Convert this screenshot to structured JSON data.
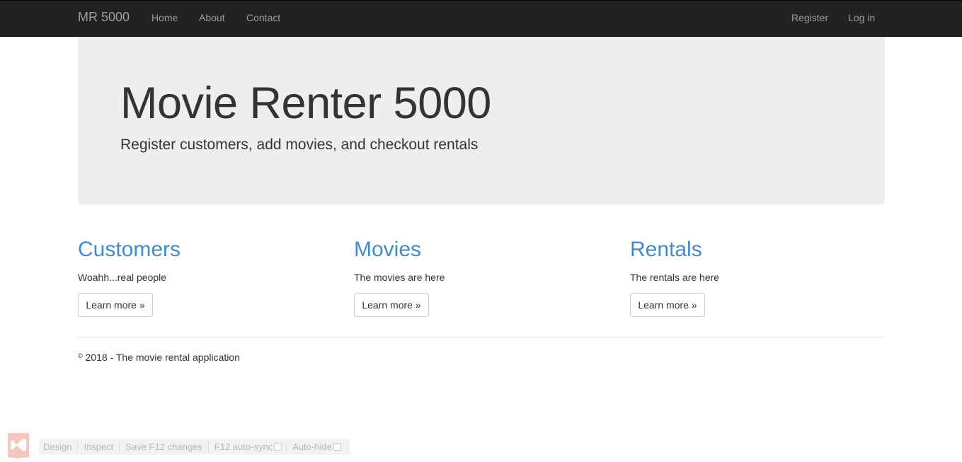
{
  "navbar": {
    "brand": "MR 5000",
    "links": [
      "Home",
      "About",
      "Contact"
    ],
    "register": "Register",
    "login": "Log in"
  },
  "jumbotron": {
    "title": "Movie Renter 5000",
    "lead": "Register customers, add movies, and checkout rentals"
  },
  "sections": [
    {
      "title": "Customers",
      "text": "Woahh...real people",
      "button": "Learn more »"
    },
    {
      "title": "Movies",
      "text": "The movies are here",
      "button": "Learn more »"
    },
    {
      "title": "Rentals",
      "text": "The rentals are here",
      "button": "Learn more »"
    }
  ],
  "footer": {
    "copyright_symbol": "©",
    "text": "2018 - The movie rental application"
  },
  "devbar": {
    "design": "Design",
    "inspect": "Inspect",
    "save": "Save F12 changes",
    "autosync": "F12 auto-sync",
    "autohide": "Auto-hide"
  },
  "colors": {
    "navbar_bg": "#222222",
    "link_blue": "#428bca",
    "jumbotron_bg": "#eeeeee"
  }
}
